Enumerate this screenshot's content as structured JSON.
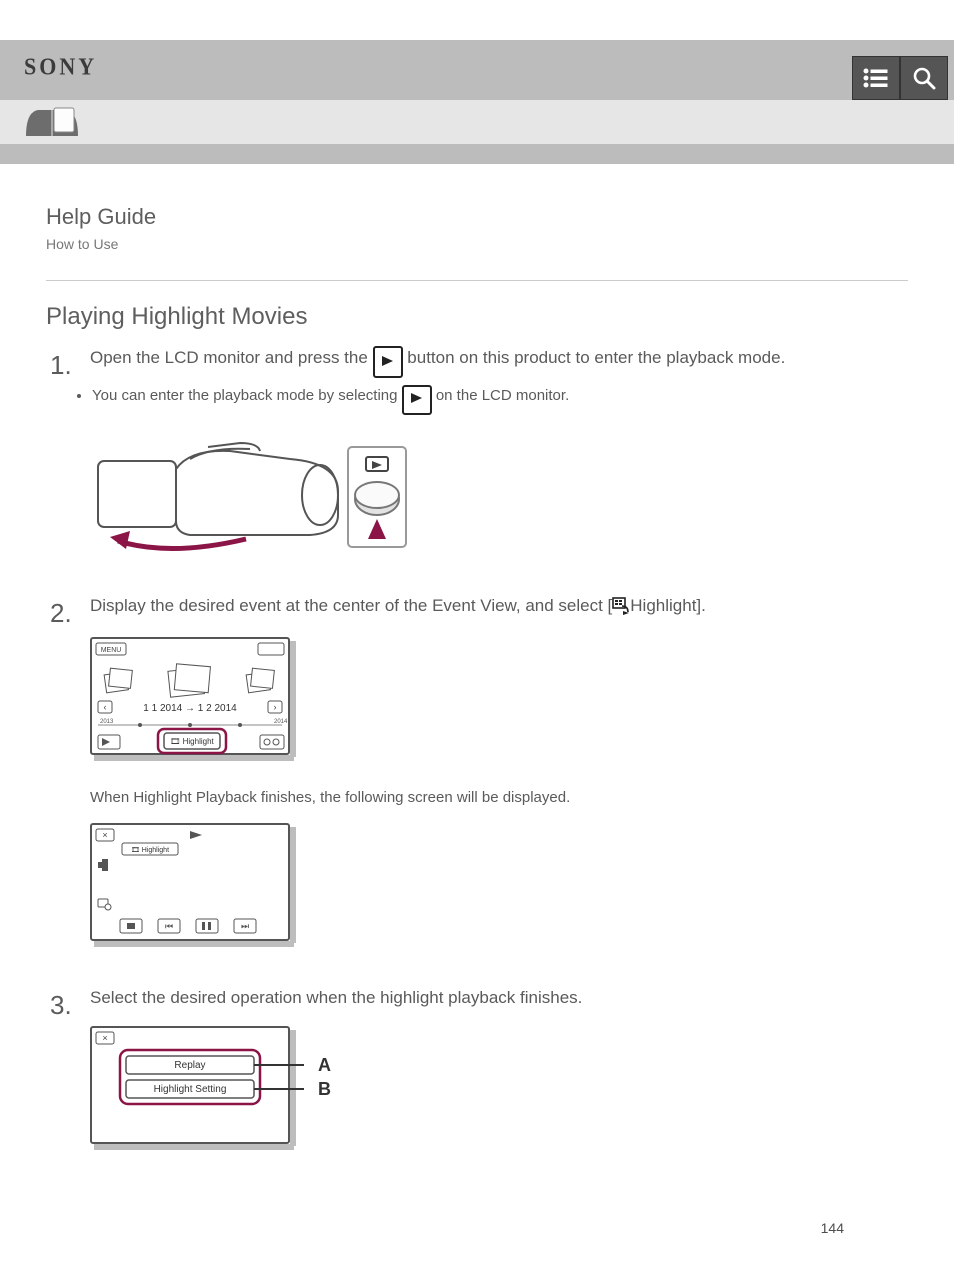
{
  "header": {
    "brand": "SONY",
    "list_btn_name": "list-icon",
    "search_btn_name": "search-icon"
  },
  "doc": {
    "title": "Help Guide",
    "subtitle": "How to Use"
  },
  "section": {
    "title": "Playing Highlight Movies"
  },
  "steps": [
    {
      "text_parts": [
        "Open the LCD monitor and press the ",
        " button on this product to enter the playback mode."
      ],
      "bullet_parts": [
        "You can enter the playback mode by selecting ",
        " on the LCD monitor."
      ]
    },
    {
      "text_parts": [
        "Display the desired event at the center of the Event View, and select [",
        "Highlight]."
      ],
      "substep": "When Highlight Playback finishes, the following screen will be displayed."
    },
    {
      "text_parts": [
        "Select the desired operation when the highlight playback finishes."
      ]
    }
  ],
  "lcd_screen": {
    "menu": "MENU",
    "date_range": "1 1 2014 → 1 2 2014",
    "highlight_btn": "Highlight"
  },
  "playback_screen": {
    "highlight_label": "Highlight"
  },
  "end_screen": {
    "replay": "Replay",
    "highlight_setting": "Highlight Setting",
    "labelA": "A",
    "labelB": "B"
  },
  "page_number": "144"
}
